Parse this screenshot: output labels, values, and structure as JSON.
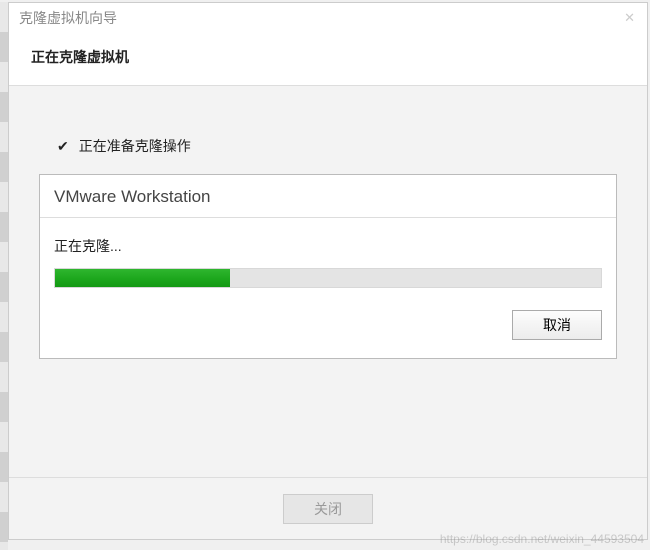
{
  "titlebar": {
    "title": "克隆虚拟机向导"
  },
  "header": {
    "title": "正在克隆虚拟机"
  },
  "step": {
    "checkmark": "✔",
    "label": "正在准备克隆操作"
  },
  "inner": {
    "title": "VMware Workstation",
    "status": "正在克隆...",
    "progress_percent": 32,
    "cancel_label": "取消"
  },
  "footer": {
    "close_label": "关闭"
  },
  "watermark": "https://blog.csdn.net/weixin_44593504",
  "colors": {
    "progress_fill": "#1ea81e",
    "body_bg": "#f3f3f3"
  }
}
